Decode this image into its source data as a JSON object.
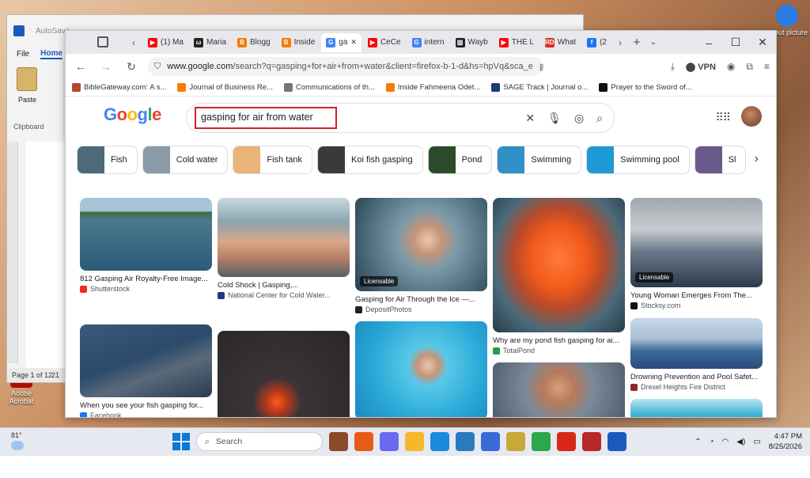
{
  "desktop": {
    "icons": [
      {
        "label": "Adobe Acrobat",
        "color": "#b30b00"
      },
      {
        "label": "about picture",
        "color": "#2a7de1"
      }
    ]
  },
  "word": {
    "autosave": "AutoSave",
    "tabs": [
      "File",
      "Home"
    ],
    "clipboard_group": "Clipboard",
    "paste_label": "Paste",
    "status": "Page 1 of 12",
    "status_words": "21"
  },
  "browser": {
    "tabs": [
      {
        "label": "(1) Ma",
        "fav_color": "#ff0000",
        "fav_glyph": "▶",
        "active": false
      },
      {
        "label": "Maria",
        "fav_color": "#222222",
        "fav_glyph": "ω",
        "active": false
      },
      {
        "label": "Blogg",
        "fav_color": "#f57d00",
        "fav_glyph": "B",
        "active": false
      },
      {
        "label": "Inside",
        "fav_color": "#f57d00",
        "fav_glyph": "B",
        "active": false
      },
      {
        "label": "ga",
        "fav_color": "#4285f4",
        "fav_glyph": "G",
        "active": true
      },
      {
        "label": "CeCe",
        "fav_color": "#ff0000",
        "fav_glyph": "▶",
        "active": false
      },
      {
        "label": "intern",
        "fav_color": "#4285f4",
        "fav_glyph": "G",
        "active": false
      },
      {
        "label": "Wayb",
        "fav_color": "#222222",
        "fav_glyph": "▥",
        "active": false
      },
      {
        "label": "THE L",
        "fav_color": "#ff0000",
        "fav_glyph": "▶",
        "active": false
      },
      {
        "label": "What",
        "fav_color": "#d93025",
        "fav_glyph": "RD",
        "active": false
      },
      {
        "label": "(2",
        "fav_color": "#1877f2",
        "fav_glyph": "f",
        "active": false
      }
    ],
    "url_domain": "www.google.com",
    "url_path": "/search?q=gasping+for+air+from+water&client=firefox-b-1-d&hs=hpVq&sca_e",
    "vpn_label": "VPN",
    "bookmarks": [
      {
        "label": "BibleGateway.com: A s...",
        "color": "#b8472b"
      },
      {
        "label": "Journal of Business Re...",
        "color": "#f57d00"
      },
      {
        "label": "Communications of th...",
        "color": "#777777"
      },
      {
        "label": "Inside Fahmeena Odet...",
        "color": "#f57d00"
      },
      {
        "label": "SAGE Track | Journal o...",
        "color": "#1a3a7a"
      },
      {
        "label": "Prayer to the Sword of...",
        "color": "#111111"
      }
    ]
  },
  "google": {
    "logo": [
      "G",
      "o",
      "o",
      "g",
      "l",
      "e"
    ],
    "query": "gasping for air from water",
    "chips": [
      {
        "label": "Fish",
        "color": "#4c6a78"
      },
      {
        "label": "Cold water",
        "color": "#8a9aa8"
      },
      {
        "label": "Fish tank",
        "color": "#e8b478"
      },
      {
        "label": "Koi fish gasping",
        "color": "#3a3a3a"
      },
      {
        "label": "Pond",
        "color": "#2c4a2a"
      },
      {
        "label": "Swimming",
        "color": "#2f8fc6"
      },
      {
        "label": "Swimming pool",
        "color": "#1e9ad6"
      },
      {
        "label": "Sl",
        "color": "#6a5a8a"
      }
    ],
    "results": [
      {
        "caption": "812 Gasping Air Royalty-Free Image...",
        "source": "Shutterstock",
        "badge": "",
        "src_color": "#ee2b24",
        "bg": "linear-gradient(180deg,#a8c4d8 0%,#a8c4d8 18%,#3a6b3f 20%,#4a7a8c 30%,#2c5a78 100%)"
      },
      {
        "caption": "Cold Shock | Gasping,...",
        "source": "National Center for Cold Water...",
        "badge": "",
        "src_color": "#1a3a7a",
        "bg": "linear-gradient(180deg,#c8d8e0 0%,#8aa4b0 30%,#d9a88a 55%,#b88068 75%,#556068 100%)"
      },
      {
        "caption": "Gasping for Air Through the Ice —...",
        "source": "DepositPhotos",
        "badge": "Licensable",
        "src_color": "#222222",
        "bg": "radial-gradient(circle at 55% 45%,#e8c8b0 0%,#c69478 16%,#7a9aa8 34%,#4a6a7a 70%,#2a3e4a 100%)"
      },
      {
        "caption": "Why are my pond fish gasping for ai...",
        "source": "TotalPond",
        "badge": "",
        "src_color": "#2a9a4a",
        "bg": "radial-gradient(ellipse at 50% 45%,#ff7a3a 0%,#f05a1a 30%,#b84a2a 48%,#4a6a7a 70%,#2a3a4a 100%)"
      },
      {
        "caption": "Young Woman Emerges From The...",
        "source": "Stocksy.com",
        "badge": "Licensable",
        "src_color": "#111111",
        "bg": "linear-gradient(180deg,#a0a8b0 0%,#c8ccd0 35%,#6a7a8a 60%,#2a3a4a 100%)"
      },
      {
        "caption": "When you see your fish gasping for...",
        "source": "Facebook",
        "badge": "",
        "src_color": "#1877f2",
        "bg": "linear-gradient(160deg,#3a5a7a 0%,#2c4a6a 45%,#5a6a7a 65%,#2a3a52 100%)"
      },
      {
        "caption": "",
        "source": "",
        "badge": "",
        "src_color": "#000000",
        "bg": "radial-gradient(circle at 45% 75%,#ff5a1a 0%,#b83a1a 10%,#3a3436 24%,#2a2628 100%)"
      },
      {
        "caption": "",
        "source": "",
        "badge": "",
        "src_color": "#000000",
        "bg": "radial-gradient(circle at 55% 45%,#e8c8b0 0%,#c69478 12%,#58c8e8 22%,#2aa8d8 60%,#1a88c0 100%)"
      },
      {
        "caption": "",
        "source": "",
        "badge": "",
        "src_color": "#000000",
        "bg": "radial-gradient(circle at 50% 40%,#d8a080 0%,#b87a5a 20%,#7a8a98 45%,#4a5a68 100%)"
      },
      {
        "caption": "Drowning Prevention and Pool Safet...",
        "source": "Drexel Heights Fire District",
        "badge": "",
        "src_color": "#8a2a2a",
        "bg": "linear-gradient(180deg,#c8d8e8 0%,#aac0d4 40%,#3a6a9a 65%,#2a4a78 100%)"
      },
      {
        "caption": "",
        "source": "",
        "badge": "",
        "src_color": "#000000",
        "bg": "linear-gradient(180deg,#b8e4f0 0%,#48b8d8 60%,#2a98c8 100%)"
      }
    ]
  },
  "taskbar": {
    "temp": "81°",
    "search_placeholder": "Search",
    "apps": [
      "#8a4a2a",
      "#e65a1a",
      "#6a6af0",
      "#f5b82a",
      "#1a8ae0",
      "#2a7ac0",
      "#3a6ad8",
      "#c8a838",
      "#2aa84a",
      "#d8281a",
      "#b8282a",
      "#1a5ac0"
    ],
    "time": "4:47 PM",
    "date": "8/25/2026"
  }
}
